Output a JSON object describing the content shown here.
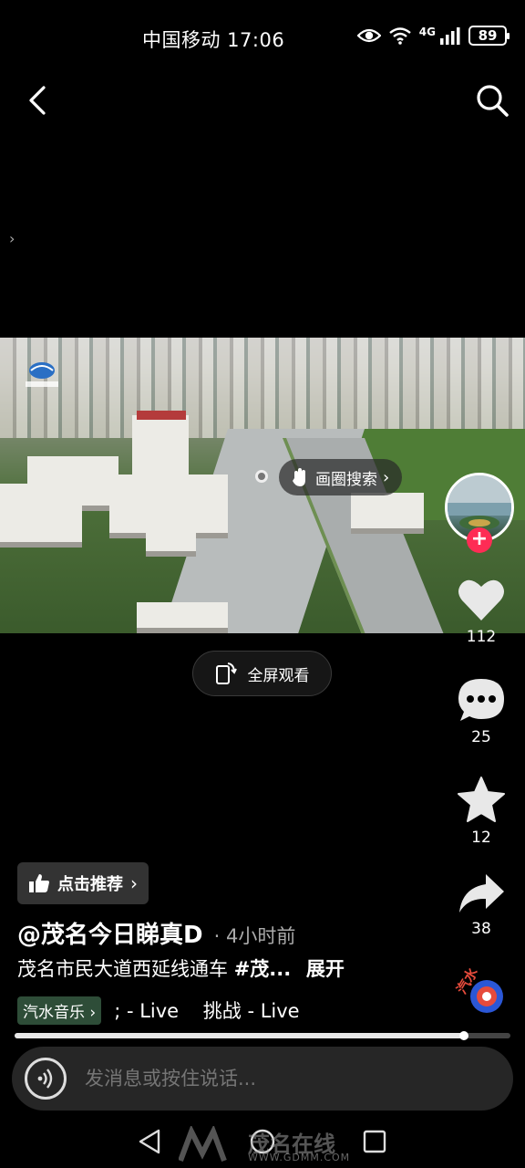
{
  "status_bar": {
    "carrier_time": "中国移动 17:06",
    "network": "4G",
    "battery": "89"
  },
  "nav": {
    "back_icon": "chevron-left-icon",
    "search_icon": "search-icon",
    "side_icon": "chevron-right-icon"
  },
  "video": {
    "circle_search_label": "画圈搜索",
    "fullscreen_label": "全屏观看"
  },
  "actions": {
    "like_count": "112",
    "comment_count": "25",
    "favorite_count": "12",
    "share_count": "38"
  },
  "post": {
    "recommend_label": "点击推荐",
    "author": "@茂名今日睇真D",
    "time_ago": "4小时前",
    "description": "茂名市民大道西延线通车",
    "hashtag": "#茂...",
    "expand_label": "展开",
    "music_badge": "汽水音乐",
    "music_text": "; - Live    挑战 - Live",
    "progress": 0.907
  },
  "message": {
    "placeholder": "发消息或按住说话..."
  },
  "watermark": {
    "text": "茂名在线",
    "url": "WWW.GDMM.COM"
  },
  "colors": {
    "accent": "#fe2c55",
    "background": "#000000",
    "music_badge_bg": "#2e4d38"
  }
}
